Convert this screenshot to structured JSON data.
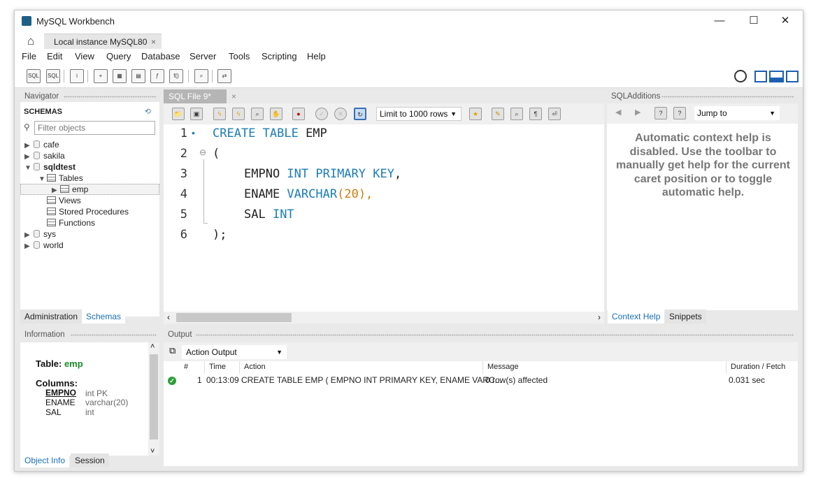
{
  "window": {
    "title": "MySQL Workbench",
    "minimize": "—",
    "maximize": "☐",
    "close": "✕"
  },
  "connection_tab": {
    "label": "Local instance MySQL80",
    "close": "×"
  },
  "menu": [
    "File",
    "Edit",
    "View",
    "Query",
    "Database",
    "Server",
    "Tools",
    "Scripting",
    "Help"
  ],
  "navigator": {
    "header": "Navigator",
    "schemas_label": "SCHEMAS",
    "filter_placeholder": "Filter objects",
    "schemas": [
      "cafe",
      "sakila",
      "sqldtest",
      "sys",
      "world"
    ],
    "sqldtest_children": {
      "tables": "Tables",
      "emp": "emp",
      "views": "Views",
      "procs": "Stored Procedures",
      "funcs": "Functions"
    },
    "tabs": {
      "admin": "Administration",
      "schemas": "Schemas"
    }
  },
  "editor": {
    "tab_label": "SQL File 9*",
    "limit_label": "Limit to 1000 rows",
    "lines": [
      "1",
      "2",
      "3",
      "4",
      "5",
      "6"
    ],
    "code": {
      "l1_kw": "CREATE TABLE",
      "l1_name": " EMP",
      "l2": "(",
      "l3_col": "EMPNO ",
      "l3_kw": "INT PRIMARY KEY",
      "l3_end": ",",
      "l4_col": "ENAME ",
      "l4_kw": "VARCHAR",
      "l4_p1": "(",
      "l4_num": "20",
      "l4_p2": "),",
      "l5_col": "SAL ",
      "l5_kw": "INT",
      "l6": ");"
    }
  },
  "sql_additions": {
    "header": "SQLAdditions",
    "jump_to": "Jump to",
    "help_text": "Automatic context help is disabled. Use the toolbar to manually get help for the current caret position or to toggle automatic help.",
    "tabs": {
      "context": "Context Help",
      "snippets": "Snippets"
    }
  },
  "information": {
    "header": "Information",
    "table_label": "Table:",
    "table_name": "emp",
    "columns_label": "Columns:",
    "columns": [
      {
        "name": "EMPNO",
        "type": "int PK"
      },
      {
        "name": "ENAME",
        "type": "varchar(20)"
      },
      {
        "name": "SAL",
        "type": "int"
      }
    ],
    "tabs": {
      "object_info": "Object Info",
      "session": "Session"
    }
  },
  "output": {
    "header": "Output",
    "selector": "Action Output",
    "columns": [
      "#",
      "Time",
      "Action",
      "Message",
      "Duration / Fetch"
    ],
    "rows": [
      {
        "num": "1",
        "time": "00:13:09",
        "action": "CREATE TABLE EMP ( EMPNO INT PRIMARY KEY, ENAME VARC...",
        "message": "0 row(s) affected",
        "duration": "0.031 sec",
        "status": "success"
      }
    ]
  },
  "colors": {
    "keyword": "#1a7cb8",
    "number": "#d07c0d",
    "link_blue": "#1a6fb8",
    "success": "#2e9e3a"
  }
}
